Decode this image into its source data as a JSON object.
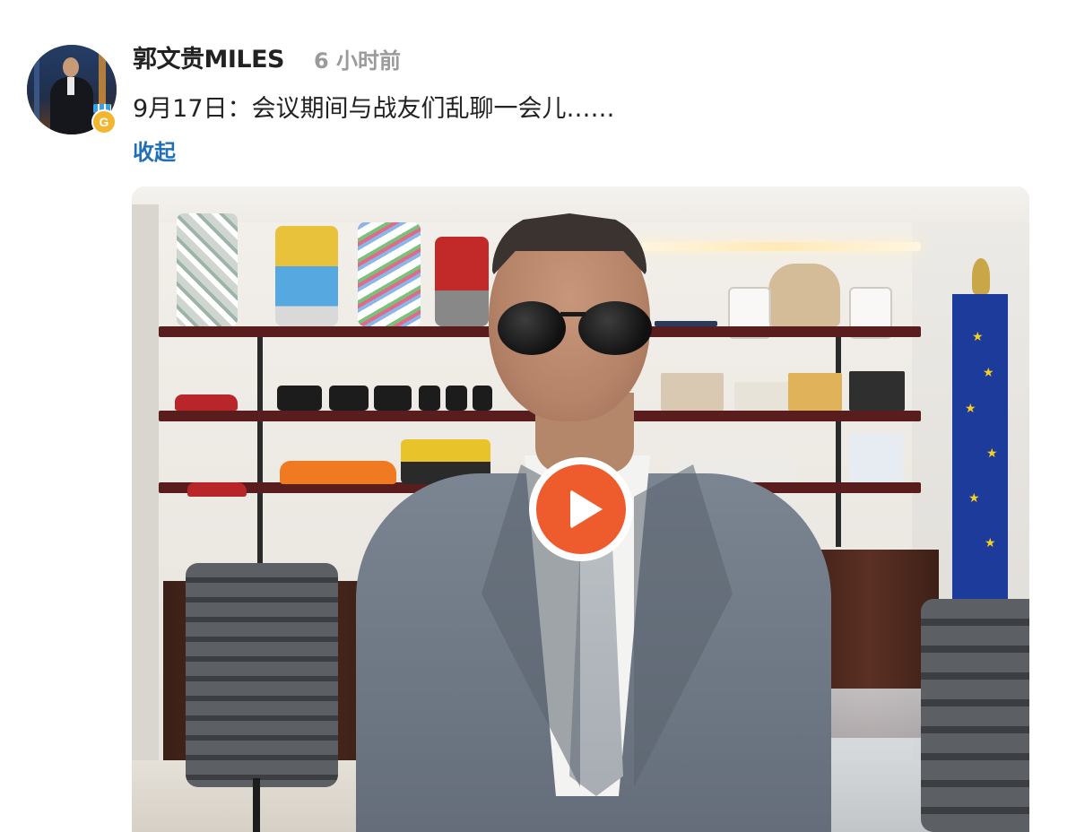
{
  "post": {
    "username": "郭文贵MILES",
    "timestamp": "6 小时前",
    "text": "9月17日：会议期间与战友们乱聊一会儿……",
    "collapse_label": "收起",
    "badge_letter": "G"
  },
  "video": {
    "play_icon": "play-icon"
  },
  "colors": {
    "link": "#1f6fb8",
    "timestamp": "#9a9a9a",
    "play": "#ee5b2d",
    "badge": "#f2b632"
  }
}
